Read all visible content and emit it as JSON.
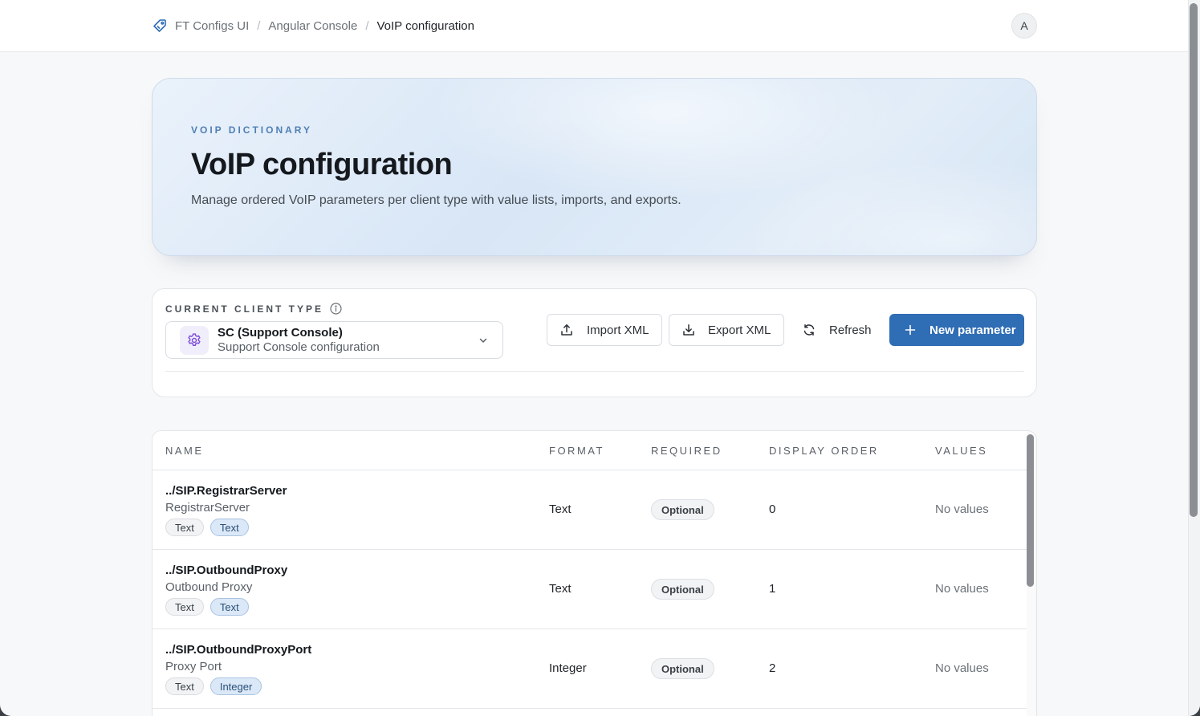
{
  "breadcrumb": {
    "items": [
      "FT Configs UI",
      "Angular Console",
      "VoIP configuration"
    ],
    "separator": "/"
  },
  "user": {
    "avatar_initial": "A"
  },
  "hero": {
    "eyebrow": "VOIP DICTIONARY",
    "title": "VoIP configuration",
    "subtitle": "Manage ordered VoIP parameters per client type with value lists, imports, and exports."
  },
  "client_type": {
    "label": "CURRENT CLIENT TYPE",
    "selected_main": "SC (Support Console)",
    "selected_sub": "Support Console configuration"
  },
  "toolbar": {
    "import_label": "Import XML",
    "export_label": "Export XML",
    "refresh_label": "Refresh",
    "new_label": "New parameter"
  },
  "table": {
    "columns": [
      "NAME",
      "FORMAT",
      "REQUIRED",
      "DISPLAY ORDER",
      "VALUES"
    ],
    "rows": [
      {
        "name": "../SIP.RegistrarServer",
        "label": "RegistrarServer",
        "tag_type": "Text",
        "tag_format": "Text",
        "format": "Text",
        "required": "Optional",
        "order": "0",
        "values": "No values"
      },
      {
        "name": "../SIP.OutboundProxy",
        "label": "Outbound Proxy",
        "tag_type": "Text",
        "tag_format": "Text",
        "format": "Text",
        "required": "Optional",
        "order": "1",
        "values": "No values"
      },
      {
        "name": "../SIP.OutboundProxyPort",
        "label": "Proxy Port",
        "tag_type": "Text",
        "tag_format": "Integer",
        "format": "Integer",
        "required": "Optional",
        "order": "2",
        "values": "No values"
      }
    ]
  },
  "icons": {
    "logo": "tag-icon",
    "info": "info-icon",
    "gear": "gear-icon",
    "chevron": "chevron-down-icon",
    "import": "upload-icon",
    "export": "download-icon",
    "refresh": "refresh-icon",
    "plus": "plus-icon"
  },
  "colors": {
    "primary": "#2f6db5",
    "eyebrow": "#4f7fb3",
    "gear_accent": "#7c4ddc"
  }
}
